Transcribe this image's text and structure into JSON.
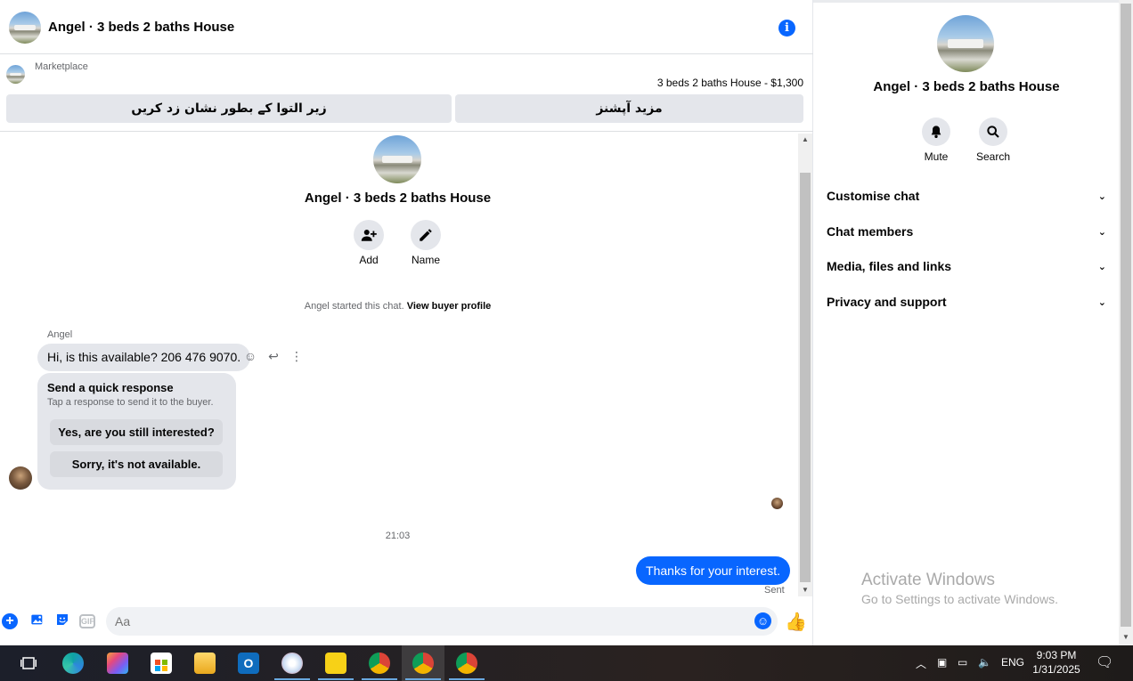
{
  "header": {
    "title": "Angel · 3 beds 2 baths House",
    "info_icon": "info-icon"
  },
  "marketplace": {
    "label": "Marketplace",
    "listing_title": "3 beds 2 baths House - $1,300",
    "mark_pending_label": "زیر التوا کے بطور نشان زد کریں",
    "more_actions_label": "مزید آپشنز"
  },
  "chat": {
    "title": "Angel · 3 beds 2 baths House",
    "add_label": "Add",
    "name_label": "Name",
    "started_text": "Angel started this chat.",
    "view_profile": "View buyer profile",
    "sender_name": "Angel",
    "incoming_message": "Hi, is this available? 206 476 9070.",
    "quick_title": "Send a quick response",
    "quick_sub": "Tap a response to send it to the buyer.",
    "quick_options": [
      "Yes, are you still interested?",
      "Sorry, it's not available."
    ],
    "timestamp": "21:03",
    "outgoing_message": "Thanks for your interest.",
    "sent_status": "Sent"
  },
  "composer": {
    "placeholder": "Aa"
  },
  "side": {
    "title": "Angel · 3 beds 2 baths House",
    "mute_label": "Mute",
    "search_label": "Search",
    "sections": [
      "Customise chat",
      "Chat members",
      "Media, files and links",
      "Privacy and support"
    ]
  },
  "watermark": {
    "line1": "Activate Windows",
    "line2": "Go to Settings to activate Windows."
  },
  "taskbar": {
    "language": "ENG",
    "time": "9:03 PM",
    "date": "1/31/2025"
  },
  "colors": {
    "accent": "#0866ff",
    "bubble_in": "#e4e6eb"
  }
}
